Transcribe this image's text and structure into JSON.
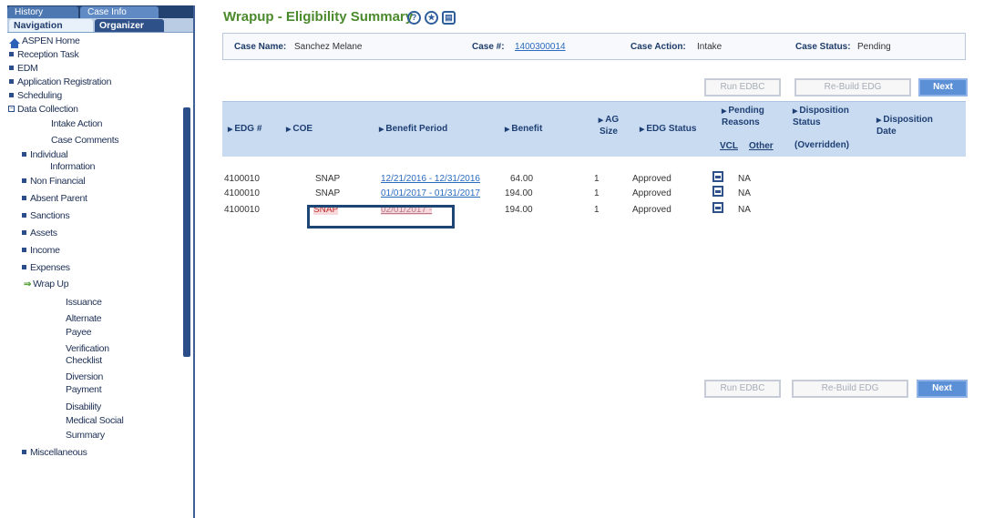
{
  "sidebar": {
    "top_tabs": [
      "History",
      "Case Info"
    ],
    "sub_tabs": [
      "Navigation",
      "Organizer"
    ],
    "items": [
      {
        "label": "ASPEN Home"
      },
      {
        "label": "Reception Task"
      },
      {
        "label": "EDM"
      },
      {
        "label": "Application Registration"
      },
      {
        "label": "Scheduling"
      },
      {
        "label": "Data Collection"
      },
      {
        "label": "Intake Action"
      },
      {
        "label": "Case Comments"
      },
      {
        "label": "Individual"
      },
      {
        "label": "Information"
      },
      {
        "label": "Non Financial"
      },
      {
        "label": "Absent Parent"
      },
      {
        "label": "Sanctions"
      },
      {
        "label": "Assets"
      },
      {
        "label": "Income"
      },
      {
        "label": "Expenses"
      },
      {
        "label": "Wrap Up"
      },
      {
        "label": "Issuance"
      },
      {
        "label": "Alternate"
      },
      {
        "label": "Payee"
      },
      {
        "label": "Verification"
      },
      {
        "label": "Checklist"
      },
      {
        "label": "Diversion"
      },
      {
        "label": "Payment"
      },
      {
        "label": "Disability"
      },
      {
        "label": "Medical Social"
      },
      {
        "label": "Summary"
      },
      {
        "label": "Miscellaneous"
      }
    ]
  },
  "header": {
    "title": "Wrapup - Eligibility Summary",
    "help_glyph": "?",
    "star_glyph": "★",
    "print_glyph": "▤"
  },
  "case": {
    "name_label": "Case Name:",
    "name_value": "Sanchez Melane",
    "number_label": "Case #:",
    "number_value": "1400300014",
    "action_label": "Case Action:",
    "action_value": "Intake",
    "status_label": "Case Status:",
    "status_value": "Pending"
  },
  "buttons": {
    "run_edbc": "Run EDBC",
    "rebuild_edg": "Re-Build EDG",
    "next": "Next"
  },
  "grid": {
    "headers": {
      "edg": "EDG #",
      "coe": "COE",
      "period": "Benefit Period",
      "benefit": "Benefit",
      "ag_size": "AG Size",
      "edg_status": "EDG Status",
      "pending": "Pending Reasons",
      "vcl": "VCL",
      "other": "Other",
      "disp_status": "Disposition Status",
      "overridden": "(Overridden)",
      "disp_date": "Disposition Date"
    },
    "rows": [
      {
        "edg": "4100010",
        "coe": "SNAP",
        "period": "12/21/2016 - 12/31/2016",
        "benefit": "64.00",
        "size": "1",
        "status": "Approved",
        "other": "NA"
      },
      {
        "edg": "4100010",
        "coe": "SNAP",
        "period": "01/01/2017 - 01/31/2017",
        "benefit": "194.00",
        "size": "1",
        "status": "Approved",
        "other": "NA"
      },
      {
        "edg": "4100010",
        "coe": "SNAP",
        "period": "02/01/2017 -",
        "benefit": "194.00",
        "size": "1",
        "status": "Approved",
        "other": "NA"
      }
    ]
  },
  "colors": {
    "title_green": "#4a8a2c",
    "nav_blue": "#2b4e8a",
    "header_bg": "#c9dbf1",
    "next_button": "#5b8fd6",
    "highlight_pink": "#f7d9dd"
  }
}
